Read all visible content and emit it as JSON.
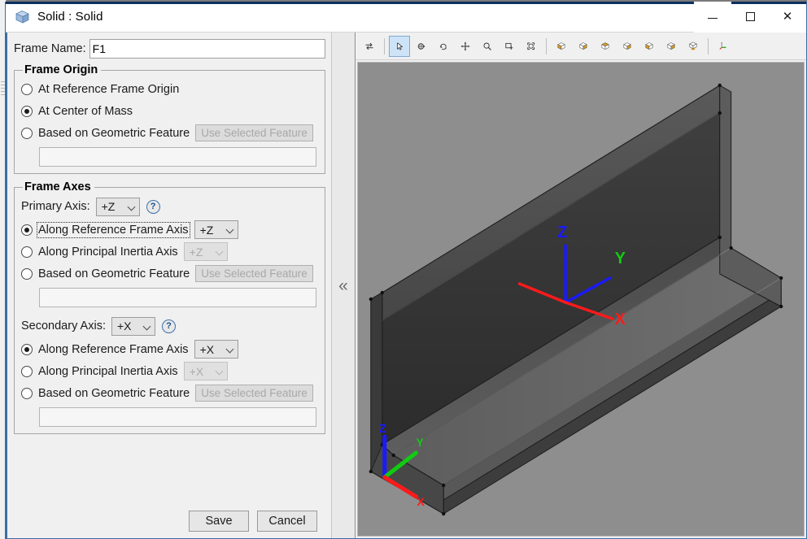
{
  "window": {
    "title": "Solid : Solid",
    "icon": "solid-cube-icon",
    "controls": {
      "minimize": "minimize-icon",
      "maximize": "maximize-icon",
      "close": "close-icon"
    }
  },
  "form": {
    "frame_name": {
      "label": "Frame Name:",
      "value": "F1",
      "placeholder": ""
    },
    "frame_origin": {
      "legend": "Frame Origin",
      "options": [
        {
          "label": "At Reference Frame Origin",
          "selected": false
        },
        {
          "label": "At Center of Mass",
          "selected": true
        },
        {
          "label": "Based on Geometric Feature",
          "selected": false
        }
      ],
      "feature_button": "Use Selected Feature",
      "feature_field_value": ""
    },
    "frame_axes": {
      "legend": "Frame Axes",
      "primary": {
        "label": "Primary Axis:",
        "value": "+Z",
        "help": "?",
        "options": [
          {
            "label": "Along Reference Frame Axis",
            "selected": true,
            "focused": true,
            "combo": "+Z",
            "combo_enabled": true
          },
          {
            "label": "Along Principal Inertia Axis",
            "selected": false,
            "focused": false,
            "combo": "+Z",
            "combo_enabled": false
          },
          {
            "label": "Based on Geometric Feature",
            "selected": false,
            "focused": false,
            "button": "Use Selected Feature"
          }
        ],
        "feature_field_value": ""
      },
      "secondary": {
        "label": "Secondary Axis:",
        "value": "+X",
        "help": "?",
        "options": [
          {
            "label": "Along Reference Frame Axis",
            "selected": true,
            "focused": false,
            "combo": "+X",
            "combo_enabled": true
          },
          {
            "label": "Along Principal Inertia Axis",
            "selected": false,
            "focused": false,
            "combo": "+X",
            "combo_enabled": false
          },
          {
            "label": "Based on Geometric Feature",
            "selected": false,
            "focused": false,
            "button": "Use Selected Feature"
          }
        ],
        "feature_field_value": ""
      }
    },
    "buttons": {
      "save": "Save",
      "cancel": "Cancel"
    }
  },
  "splitter": {
    "collapse_glyph": "«"
  },
  "toolbar": {
    "items": [
      {
        "name": "toggle-view-icon",
        "active": false
      },
      {
        "name": "select-cursor-icon",
        "active": true
      },
      {
        "name": "rotate-view-icon",
        "active": false
      },
      {
        "name": "orbit-view-icon",
        "active": false
      },
      {
        "name": "pan-view-icon",
        "active": false
      },
      {
        "name": "zoom-view-icon",
        "active": false
      },
      {
        "name": "zoom-window-icon",
        "active": false
      },
      {
        "name": "fit-to-window-icon",
        "active": false
      },
      {
        "name": "view-front-icon",
        "active": false
      },
      {
        "name": "view-top-icon",
        "active": false
      },
      {
        "name": "view-right-icon",
        "active": false
      },
      {
        "name": "view-bottom-icon",
        "active": false
      },
      {
        "name": "view-left-icon",
        "active": false
      },
      {
        "name": "view-back-icon",
        "active": false
      },
      {
        "name": "view-isometric-icon",
        "active": false
      },
      {
        "name": "show-axes-icon",
        "active": false
      }
    ]
  },
  "viewport": {
    "background_color": "#8e8e8e",
    "model_name": "l-angle-beam",
    "model_color": "#3a3a3a",
    "frame_triad": {
      "labels": {
        "x": "X",
        "y": "Y",
        "z": "Z"
      },
      "colors": {
        "x": "#ff1a1a",
        "y": "#10cc10",
        "z": "#1a1aff"
      }
    },
    "world_triad": {
      "labels": {
        "x": "X",
        "y": "Y",
        "z": "Z"
      },
      "colors": {
        "x": "#ff1a1a",
        "y": "#10cc10",
        "z": "#1a1aff"
      }
    }
  },
  "colors": {
    "accent": "#3b6ea5",
    "panel": "#f0f0f0",
    "toolbar_active": "#cde3f7",
    "viewport_bg": "#8e8e8e"
  }
}
